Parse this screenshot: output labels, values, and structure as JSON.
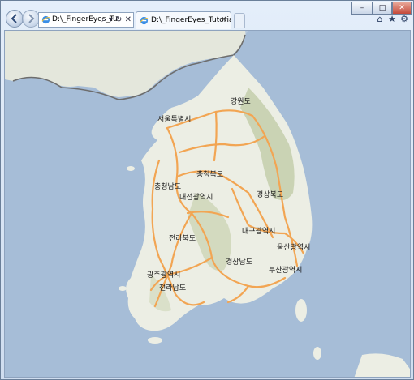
{
  "browser": {
    "address_text": "D:\\_FingerEyes_Tu",
    "address_tools": "⌕ ▾ ↻ ✕",
    "tab_label": "D:\\_FingerEyes_Tutorials_...",
    "tab_close": "✕",
    "caption": {
      "minimize": "–",
      "maximize": "□",
      "close": "✕"
    },
    "toolbar_icons": [
      "home-icon",
      "favorites-star-icon",
      "settings-gear-icon"
    ],
    "toolbar_glyphs": {
      "home": "⌂",
      "favorites": "★",
      "settings": "⚙"
    }
  },
  "map": {
    "labels": {
      "gangwon": "강원도",
      "seoul": "서울특별시",
      "chungbuk": "충청북도",
      "chungnam": "충청남도",
      "daejeon": "대전광역시",
      "gyeongbuk": "경상북도",
      "jeonbuk": "전라북도",
      "daegu": "대구광역시",
      "ulsan": "울산광역시",
      "gyeongnam": "경상남도",
      "busan": "부산광역시",
      "gwangju": "광주광역시",
      "jeonnam": "전라남도"
    },
    "colors": {
      "sea": "#a6bdd7",
      "land": "#eceee4",
      "mountain": "#c7cfae",
      "road": "#f2a553",
      "border": "#7a7a7a"
    }
  }
}
